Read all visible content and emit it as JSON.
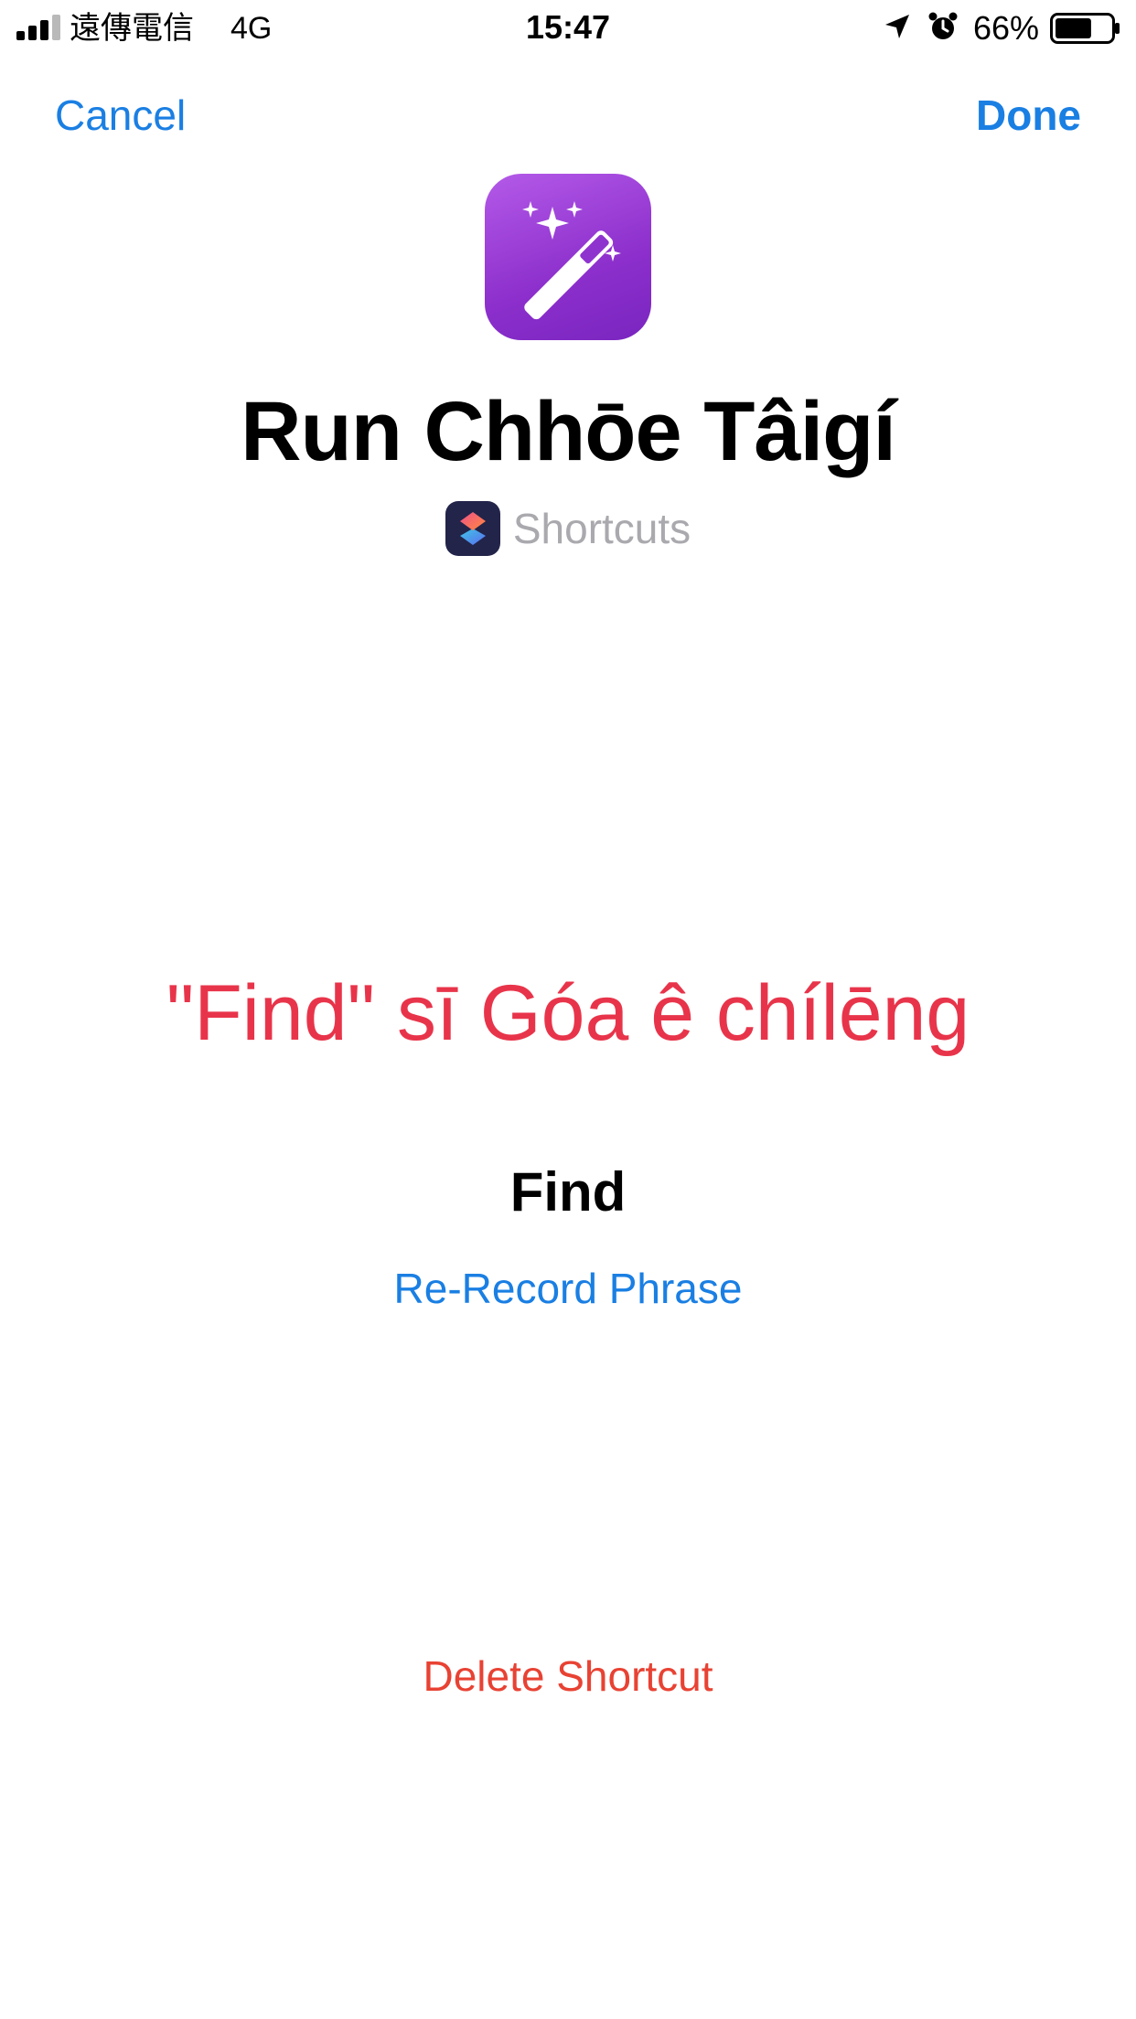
{
  "status_bar": {
    "carrier": "遠傳電信",
    "network": "4G",
    "time": "15:47",
    "battery": "66%",
    "battery_level": 0.66,
    "icons": [
      "signal-icon",
      "location-arrow-icon",
      "alarm-clock-icon",
      "battery-icon"
    ]
  },
  "nav": {
    "cancel_label": "Cancel",
    "done_label": "Done"
  },
  "header": {
    "icon": "magic-wand-icon",
    "title": "Run Chhōe Tâigí",
    "app_icon": "shortcuts-app-icon",
    "app_name": "Shortcuts"
  },
  "body": {
    "phrase_heading": "\"Find\" sī Góa ê chílēng",
    "phrase": "Find",
    "rerecord_label": "Re-Record Phrase",
    "delete_label": "Delete Shortcut"
  },
  "colors": {
    "accent": "#1a7fe3",
    "heading_red": "#e8344a",
    "delete_red": "#e84233",
    "icon_purple": "#9b3fd6",
    "secondary_text": "#a9a9ae"
  }
}
